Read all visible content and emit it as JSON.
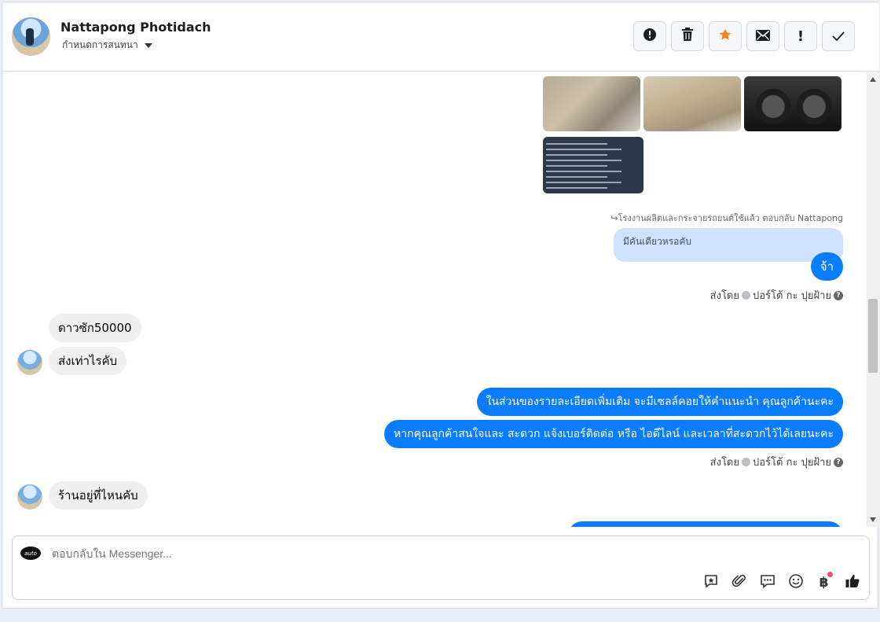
{
  "header": {
    "name": "Nattapong Photidach",
    "assign_label": "กำหนดการสนทนา"
  },
  "actions": [
    {
      "icon": "alert-circle-icon",
      "glyph": "!"
    },
    {
      "icon": "trash-icon",
      "glyph": "🗑"
    },
    {
      "icon": "star-icon",
      "glyph": "★",
      "color": "#f5821f"
    },
    {
      "icon": "envelope-icon",
      "glyph": "✉"
    },
    {
      "icon": "exclamation-icon",
      "glyph": "!"
    },
    {
      "icon": "check-icon",
      "glyph": "✓"
    }
  ],
  "conversation": {
    "reply_meta": "โรงงานผลิตและกระจายรถยนต์ใช้แล้ว ตอบกลับ Nattapong",
    "quoted_text": "มีคันเดียวหรอคับ",
    "reply_1": "จ้า",
    "sent_by_1": "ส่งโดย",
    "sender_1": "ปอร์โต้ กะ ปุยฝ้าย",
    "incoming_1": "ดาวซัก50000",
    "incoming_2": "ส่งเท่าไรคับ",
    "outgoing_2": "ในส่วนของรายละเอียดเพิ่มเติม จะมีเซลล์คอยให้คำแนะนำ คุณลูกค้านะคะ",
    "outgoing_3": "หากคุณลูกค้าสนใจและ สะดวก แจ้งเบอร์ติดต่อ หรือ ไอดีไลน์ และเวลาที่สะดวกไว้ได้เลยนะคะ",
    "sent_by_2": "ส่งโดย",
    "sender_2": "ปอร์โต้ กะ ปุยฝ้าย",
    "incoming_3": "ร้านอยู่ที่ไหนคับ"
  },
  "composer": {
    "placeholder": "ตอบกลับใน Messenger...",
    "logo_text": "auto"
  },
  "colors": {
    "accent": "#0a7cff",
    "quoted_bg": "#cfe2fb",
    "star": "#f5821f"
  }
}
